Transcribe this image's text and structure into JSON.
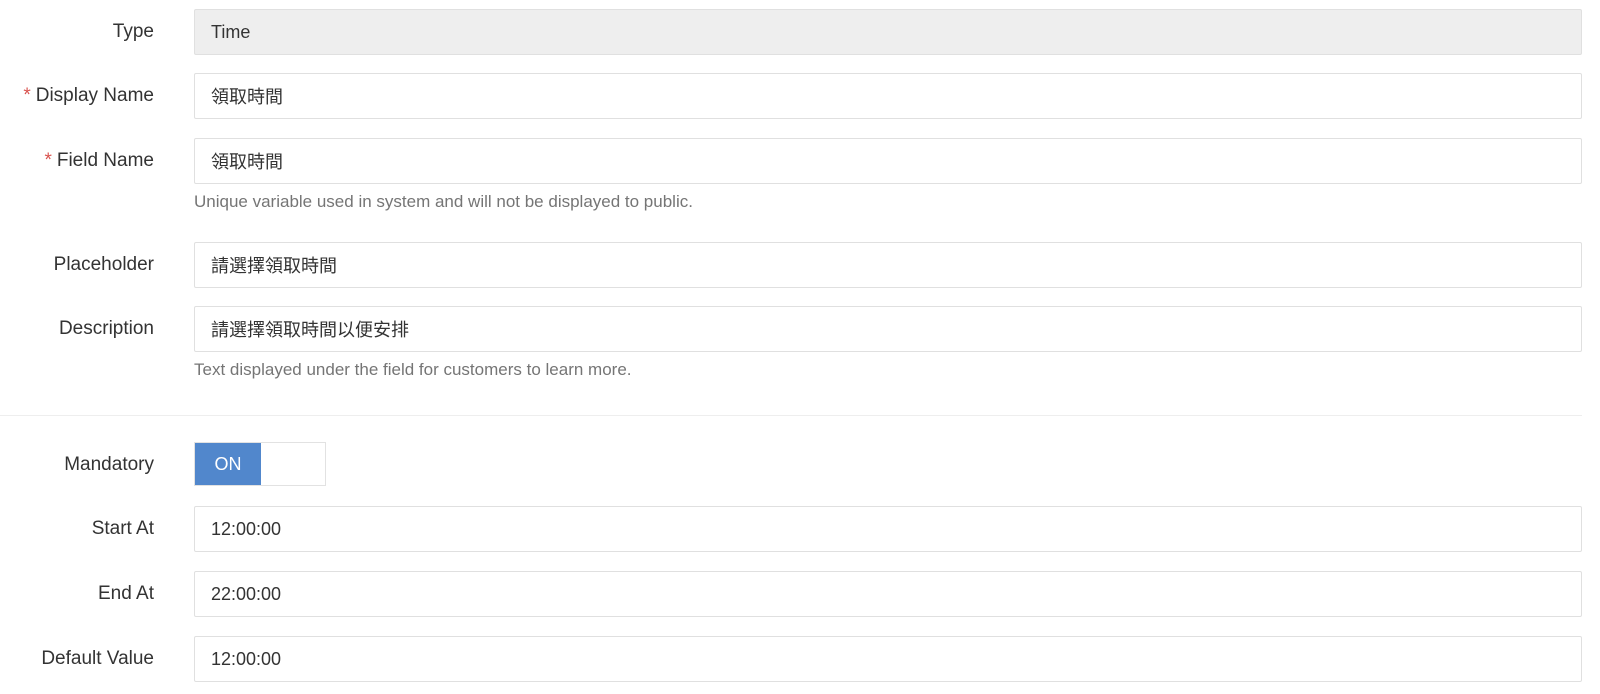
{
  "form": {
    "type": {
      "label": "Type",
      "value": "Time"
    },
    "display_name": {
      "label": "Display Name",
      "required_mark": "*",
      "value": "領取時間"
    },
    "field_name": {
      "label": "Field Name",
      "required_mark": "*",
      "value": "領取時間",
      "help": "Unique variable used in system and will not be displayed to public."
    },
    "placeholder": {
      "label": "Placeholder",
      "value": "請選擇領取時間"
    },
    "description": {
      "label": "Description",
      "value": "請選擇領取時間以便安排",
      "help": "Text displayed under the field for customers to learn more."
    },
    "mandatory": {
      "label": "Mandatory",
      "state": "ON"
    },
    "start_at": {
      "label": "Start At",
      "value": "12:00:00"
    },
    "end_at": {
      "label": "End At",
      "value": "22:00:00"
    },
    "default_value": {
      "label": "Default Value",
      "value": "12:00:00"
    }
  },
  "colors": {
    "accent": "#5187cc",
    "required": "#d9534f",
    "disabled_bg": "#eeeeee",
    "border": "#e0e0e0",
    "help_text": "#757575"
  }
}
